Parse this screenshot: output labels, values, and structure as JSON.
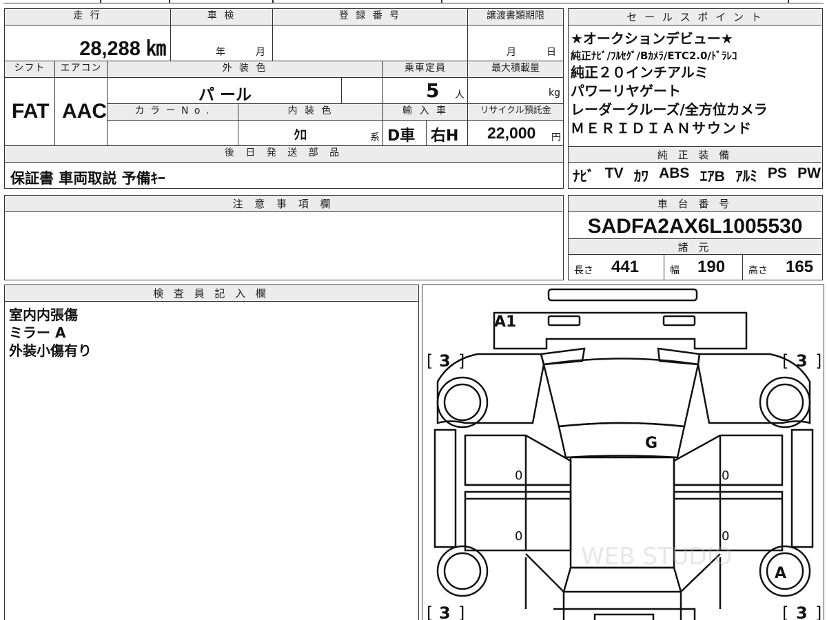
{
  "top_strip": {
    "partial_text": ""
  },
  "vehicle_info": {
    "mileage": {
      "label": "走 行",
      "value": "28,288 ㎞"
    },
    "inspection": {
      "label": "車 検",
      "year_unit": "年",
      "month_unit": "月"
    },
    "registration": {
      "label": "登 録 番 号",
      "value": ""
    },
    "transfer_deadline": {
      "label": "譲渡書類期限",
      "month_unit": "月",
      "day_unit": "日"
    },
    "shift": {
      "label": "シフト",
      "value": "FAT"
    },
    "aircon": {
      "label": "エアコン",
      "value": "AAC"
    },
    "exterior_color": {
      "label": "外 装 色",
      "value": "パ ール"
    },
    "capacity": {
      "label": "乗車定員",
      "value": "5",
      "unit": "人"
    },
    "max_load": {
      "label": "最大積載量",
      "unit": "kg"
    },
    "color_no": {
      "label": "カ ラ ー N o .",
      "value": ""
    },
    "interior_color": {
      "label": "内 装 色",
      "value": "ｸﾛ",
      "suffix": "系"
    },
    "import": {
      "label": "輸 入 車",
      "type": "D車",
      "steering": "右H"
    },
    "recycle": {
      "label": "リサイクル預託金",
      "value": "22,000",
      "unit": "円"
    },
    "later_parts": {
      "label": "後 日 発 送 部 品",
      "value": "保証書 車両取説 予備ｷｰ"
    }
  },
  "sales_points": {
    "label": "セ ー ル ス ポ イ ン ト",
    "lines": [
      "★オークションデビュー★",
      "純正ﾅﾋﾞ/ﾌﾙｾｸﾞ/Bｶﾒﾗ/ETC2.0/ﾄﾞﾗﾚｺ",
      "純正２０インチアルミ",
      "パワーリヤゲート",
      "レーダークルーズ/全方位カメラ",
      "ＭＥＲＩＤＩＡＮサウンド"
    ]
  },
  "equipment": {
    "label": "純 正 装 備",
    "items": [
      "ﾅﾋﾞ",
      "TV",
      "ｶﾜ",
      "ABS",
      "ｴｱB",
      "ｱﾙﾐ",
      "PS",
      "PW"
    ]
  },
  "notes": {
    "label": "注 意 事 項 欄",
    "value": ""
  },
  "chassis": {
    "label": "車 台 番 号",
    "value": "SADFA2AX6L1005530"
  },
  "specs": {
    "label": "諸 元",
    "length": {
      "label": "長さ",
      "value": "441"
    },
    "width": {
      "label": "幅",
      "value": "190"
    },
    "height": {
      "label": "高さ",
      "value": "165"
    }
  },
  "inspector": {
    "label": "検 査 員 記 入 欄",
    "lines": [
      "室内内張傷",
      "ミラー A",
      "外装小傷有り"
    ]
  },
  "diagram": {
    "marks": {
      "front_bumper": "A1",
      "windshield": "G",
      "rear_right_wheel": "A"
    },
    "tire_front_left": "3",
    "tire_front_right": "3",
    "tire_rear_left": "3",
    "tire_rear_right": "3",
    "door_front_left": "0",
    "door_rear_left": "0",
    "door_front_right": "0",
    "door_rear_right": "0",
    "watermark": "WEB STUDIO"
  }
}
